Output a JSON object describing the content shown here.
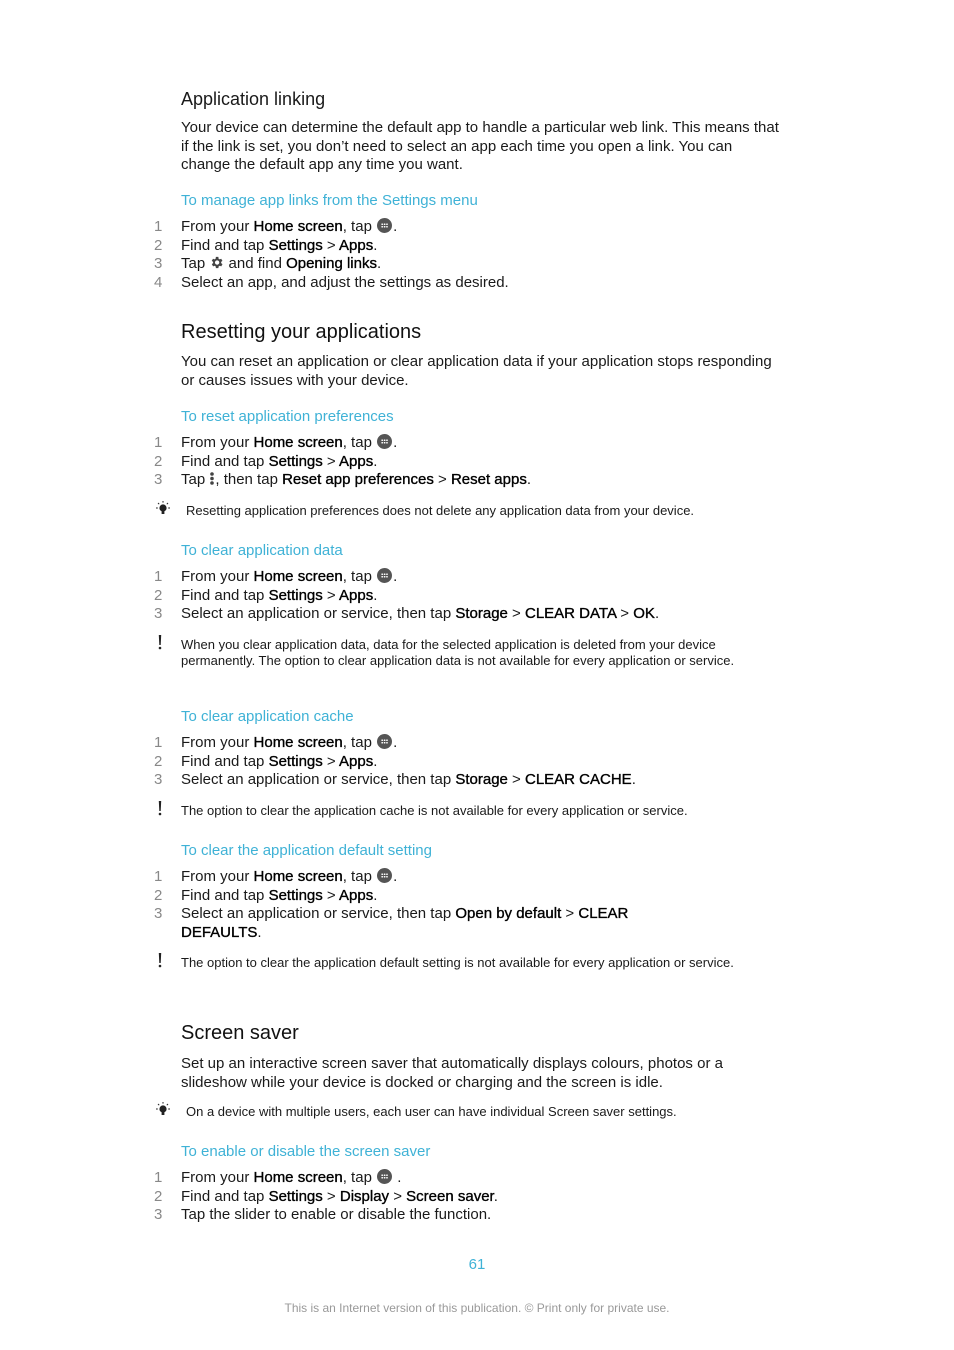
{
  "sections": {
    "app_linking": {
      "title": "Application linking",
      "body": "Your device can determine the default app to handle a particular web link. This means that if the link is set, you don’t need to select an app each time you open a link. You can change the default app any time you want.",
      "procedure": {
        "title": "To manage app links from the Settings menu",
        "steps": [
          {
            "num": "1",
            "t1": "From your ",
            "b1": "Home screen",
            "t2": ", tap ",
            "t3": "."
          },
          {
            "num": "2",
            "t1": "Find and tap ",
            "b1": "Settings",
            "t2": " > ",
            "b2": "Apps",
            "t3": "."
          },
          {
            "num": "3",
            "t1": "Tap ",
            "t2": " and find ",
            "b1": "Opening links",
            "t3": "."
          },
          {
            "num": "4",
            "t1": "Select an app, and adjust the settings as desired."
          }
        ]
      }
    },
    "resetting": {
      "title": "Resetting your applications",
      "body": "You can reset an application or clear application data if your application stops responding or causes issues with your device.",
      "reset_prefs": {
        "title": "To reset application preferences",
        "steps": [
          {
            "num": "1",
            "t1": "From your ",
            "b1": "Home screen",
            "t2": ", tap ",
            "t3": "."
          },
          {
            "num": "2",
            "t1": "Find and tap ",
            "b1": "Settings",
            "t2": " > ",
            "b2": "Apps",
            "t3": "."
          },
          {
            "num": "3",
            "t1": "Tap ",
            "t2": ", then tap ",
            "b1": "Reset app preferences",
            "t3": " > ",
            "b2": "Reset apps",
            "t4": "."
          }
        ],
        "tip": "Resetting application preferences does not delete any application data from your device."
      },
      "clear_data": {
        "title": "To clear application data",
        "steps": [
          {
            "num": "1",
            "t1": "From your ",
            "b1": "Home screen",
            "t2": ", tap ",
            "t3": "."
          },
          {
            "num": "2",
            "t1": "Find and tap ",
            "b1": "Settings",
            "t2": " > ",
            "b2": "Apps",
            "t3": "."
          },
          {
            "num": "3",
            "t1": "Select an application or service, then tap ",
            "b1": "Storage",
            "t2": " > ",
            "b2": "CLEAR DATA",
            "t3": " > ",
            "b3": "OK",
            "t4": "."
          }
        ],
        "warning": "When you clear application data, data for the selected application is deleted from your device permanently. The option to clear application data is not available for every application or service."
      },
      "clear_cache": {
        "title": "To clear application cache",
        "steps": [
          {
            "num": "1",
            "t1": "From your ",
            "b1": "Home screen",
            "t2": ", tap ",
            "t3": "."
          },
          {
            "num": "2",
            "t1": "Find and tap ",
            "b1": "Settings",
            "t2": " > ",
            "b2": "Apps",
            "t3": "."
          },
          {
            "num": "3",
            "t1": "Select an application or service, then tap ",
            "b1": "Storage",
            "t2": " > ",
            "b2": "CLEAR CACHE",
            "t3": "."
          }
        ],
        "warning": "The option to clear the application cache is not available for every application or service."
      },
      "clear_default": {
        "title": "To clear the application default setting",
        "steps": [
          {
            "num": "1",
            "t1": "From your ",
            "b1": "Home screen",
            "t2": ", tap ",
            "t3": "."
          },
          {
            "num": "2",
            "t1": "Find and tap ",
            "b1": "Settings",
            "t2": " > ",
            "b2": "Apps",
            "t3": "."
          },
          {
            "num": "3",
            "t1": "Select an application or service, then tap ",
            "b1": "Open by default",
            "t2": " > ",
            "b2": "CLEAR",
            "b3": "DEFAULTS",
            "t3": "."
          }
        ],
        "warning": "The option to clear the application default setting is not available for every application or service."
      }
    },
    "screen_saver": {
      "title": "Screen saver",
      "body": "Set up an interactive screen saver that automatically displays colours, photos or a slideshow while your device is docked or charging and the screen is idle.",
      "tip": "On a device with multiple users, each user can have individual Screen saver settings.",
      "procedure": {
        "title": "To enable or disable the screen saver",
        "steps": [
          {
            "num": "1",
            "t1": "From your ",
            "b1": "Home screen",
            "t2": ", tap ",
            "t3": " ."
          },
          {
            "num": "2",
            "t1": "Find and tap ",
            "b1": "Settings",
            "t2": " > ",
            "b2": "Display",
            "t3": " > ",
            "b3": "Screen saver",
            "t4": "."
          },
          {
            "num": "3",
            "t1": "Tap the slider to enable or disable the function."
          }
        ]
      }
    }
  },
  "footer": {
    "page_number": "61",
    "notice": "This is an Internet version of this publication. © Print only for private use."
  },
  "colors": {
    "accent": "#3fb2d6",
    "text": "#1a1a1a",
    "step_number": "#888888",
    "footer_text": "#999999"
  }
}
